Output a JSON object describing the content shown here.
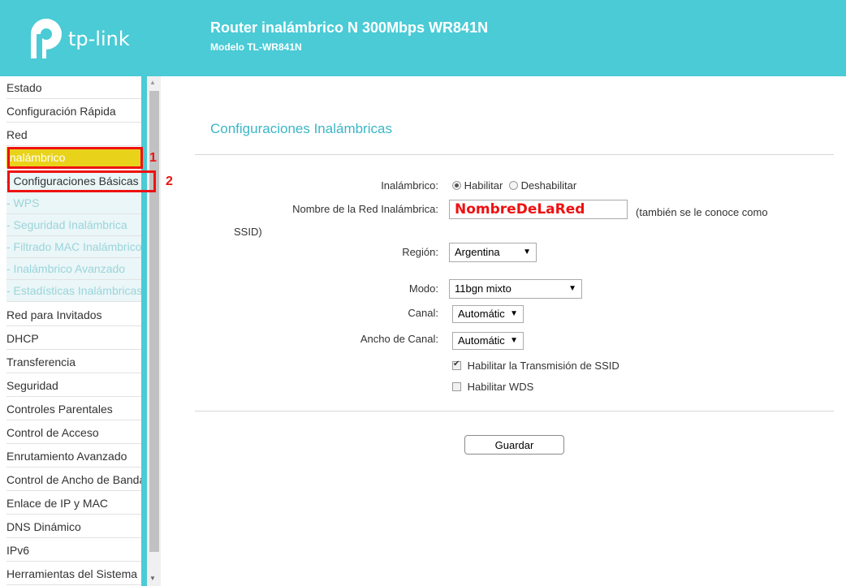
{
  "header": {
    "logo_text": "tp-link",
    "title": "Router inalámbrico N 300Mbps WR841N",
    "model": "Modelo TL-WR841N"
  },
  "sidebar": {
    "items": [
      {
        "label": "Estado"
      },
      {
        "label": "Configuración Rápida"
      },
      {
        "label": "Red"
      },
      {
        "label": "Inalámbrico"
      },
      {
        "label": "- Configuraciones Básicas"
      },
      {
        "label": "- WPS"
      },
      {
        "label": "- Seguridad Inalámbrica"
      },
      {
        "label": "- Filtrado MAC Inalámbrico"
      },
      {
        "label": "- Inalámbrico Avanzado"
      },
      {
        "label": "- Estadísticas Inalámbricas"
      },
      {
        "label": "Red para Invitados"
      },
      {
        "label": "DHCP"
      },
      {
        "label": "Transferencia"
      },
      {
        "label": "Seguridad"
      },
      {
        "label": "Controles Parentales"
      },
      {
        "label": "Control de Acceso"
      },
      {
        "label": "Enrutamiento Avanzado"
      },
      {
        "label": "Control de Ancho de Banda"
      },
      {
        "label": "Enlace de IP y MAC"
      },
      {
        "label": "DNS Dinámico"
      },
      {
        "label": "IPv6"
      },
      {
        "label": "Herramientas del Sistema"
      }
    ]
  },
  "callouts": [
    "1",
    "2"
  ],
  "main": {
    "title": "Configuraciones Inalámbricas",
    "wireless_label": "Inalámbrico:",
    "enable_label": "Habilitar",
    "disable_label": "Deshabilitar",
    "wireless_enabled": true,
    "ssid_label": "Nombre de la Red Inalámbrica:",
    "ssid_value": "NombreDeLaRed",
    "ssid_note": "(también se le conoce como",
    "ssid_note2": "SSID)",
    "region_label": "Región:",
    "region_value": "Argentina",
    "mode_label": "Modo:",
    "mode_value": "11bgn mixto",
    "channel_label": "Canal:",
    "channel_value": "Automátic",
    "width_label": "Ancho de Canal:",
    "width_value": "Automátic",
    "ssid_broadcast_label": "Habilitar la Transmisión de SSID",
    "ssid_broadcast_checked": true,
    "wds_label": "Habilitar WDS",
    "wds_checked": false,
    "save_label": "Guardar"
  },
  "colors": {
    "brand": "#4acbd6",
    "active_menu": "#e9d31a",
    "callout": "#ee1111"
  }
}
